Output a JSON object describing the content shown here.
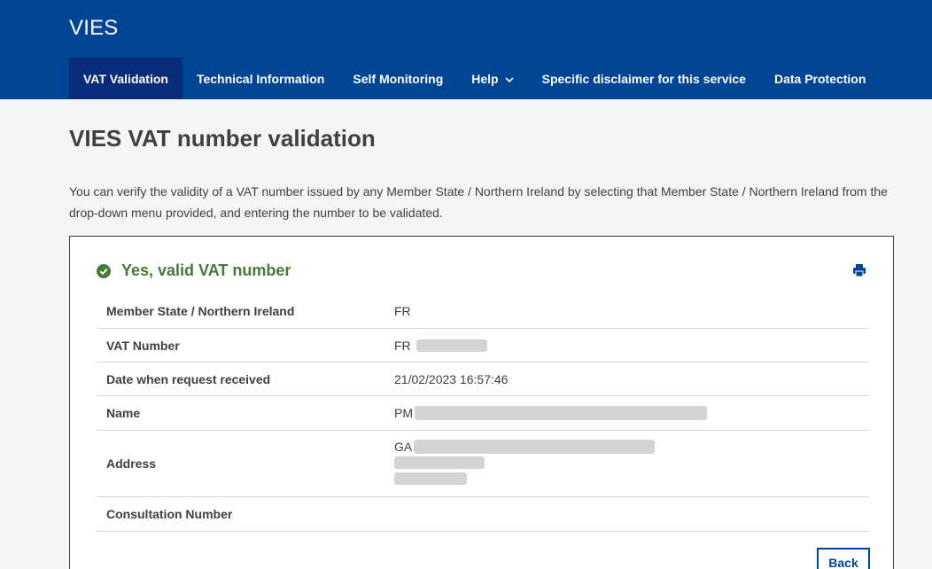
{
  "header": {
    "site_title": "VIES",
    "nav": [
      {
        "label": "VAT Validation"
      },
      {
        "label": "Technical Information"
      },
      {
        "label": "Self Monitoring"
      },
      {
        "label": "Help"
      },
      {
        "label": "Specific disclaimer for this service"
      },
      {
        "label": "Data Protection"
      }
    ]
  },
  "main": {
    "title": "VIES VAT number validation",
    "intro": "You can verify the validity of a VAT number issued by any Member State / Northern Ireland by selecting that Member State / Northern Ireland from the drop-down menu provided, and entering the number to be validated."
  },
  "result": {
    "status_icon": "check-circle-icon",
    "status_text": "Yes, valid VAT number",
    "status_color": "#467a39",
    "print_icon": "print-icon",
    "rows": [
      {
        "label": "Member State / Northern Ireland",
        "value": "FR"
      },
      {
        "label": "VAT Number",
        "value": "FR"
      },
      {
        "label": "Date when request received",
        "value": "21/02/2023 16:57:46"
      },
      {
        "label": "Name",
        "value": "PM"
      },
      {
        "label": "Address",
        "value": "GA"
      },
      {
        "label": "Consultation Number",
        "value": ""
      }
    ],
    "back_label": "Back"
  },
  "colors": {
    "brand": "#004494",
    "nav_active": "#082b7a",
    "valid": "#467a39"
  }
}
